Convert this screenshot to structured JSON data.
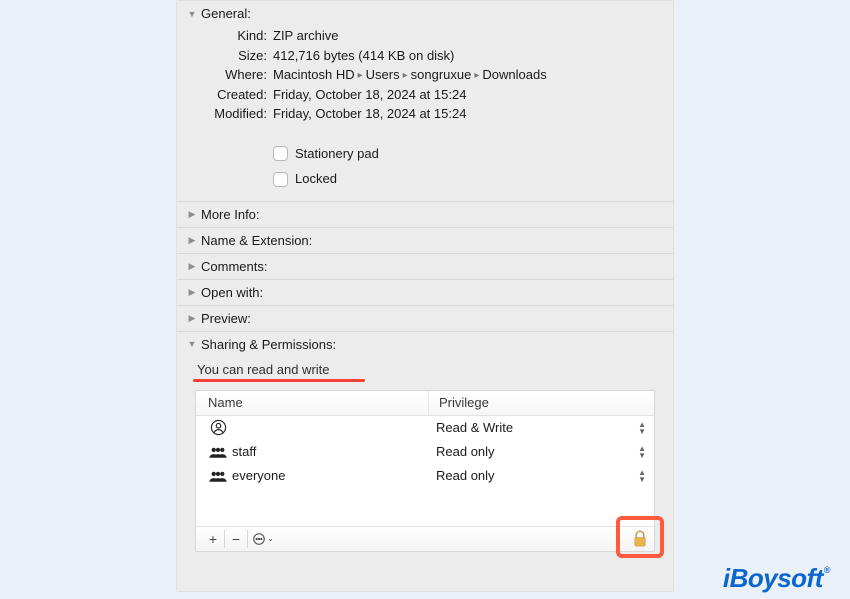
{
  "sections": {
    "general": {
      "title": "General:",
      "kind_label": "Kind:",
      "kind_value": "ZIP archive",
      "size_label": "Size:",
      "size_value": "412,716 bytes (414 KB on disk)",
      "where_label": "Where:",
      "where_segments": [
        "Macintosh HD",
        "Users",
        "songruxue",
        "Downloads"
      ],
      "created_label": "Created:",
      "created_value": "Friday, October 18, 2024 at 15:24",
      "modified_label": "Modified:",
      "modified_value": "Friday, October 18, 2024 at 15:24",
      "stationery_label": "Stationery pad",
      "locked_label": "Locked"
    },
    "more_info": {
      "title": "More Info:"
    },
    "name_ext": {
      "title": "Name & Extension:"
    },
    "comments": {
      "title": "Comments:"
    },
    "open_with": {
      "title": "Open with:"
    },
    "preview": {
      "title": "Preview:"
    },
    "sharing": {
      "title": "Sharing & Permissions:",
      "hint": "You can read and write",
      "columns": {
        "name": "Name",
        "privilege": "Privilege"
      },
      "rows": [
        {
          "icon": "person-circle-icon",
          "name": "",
          "privilege": "Read & Write"
        },
        {
          "icon": "group-icon",
          "name": "staff",
          "privilege": "Read only"
        },
        {
          "icon": "group-icon",
          "name": "everyone",
          "privilege": "Read only"
        }
      ],
      "toolbar": {
        "add": "+",
        "remove": "−",
        "more": "⊙",
        "lock": "lock-icon"
      }
    }
  },
  "brand": "iBoysoft",
  "brand_mark": "®"
}
